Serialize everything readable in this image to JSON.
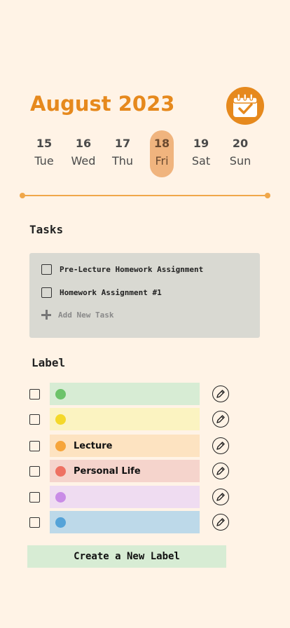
{
  "header": {
    "title": "August 2023",
    "calendar_icon": "calendar-check-icon",
    "accent_color": "#e6891d"
  },
  "days": [
    {
      "num": "15",
      "weekday": "Tue"
    },
    {
      "num": "16",
      "weekday": "Wed"
    },
    {
      "num": "17",
      "weekday": "Thu"
    },
    {
      "num": "18",
      "weekday": "Fri",
      "selected": true
    },
    {
      "num": "19",
      "weekday": "Sat"
    },
    {
      "num": "20",
      "weekday": "Sun"
    }
  ],
  "tasks": {
    "title": "Tasks",
    "items": [
      {
        "label": "Pre-Lecture Homework Assignment",
        "checked": false
      },
      {
        "label": "Homework Assignment #1",
        "checked": false
      }
    ],
    "add_label": "Add New Task"
  },
  "labels": {
    "title": "Label",
    "items": [
      {
        "text": "",
        "bar_color": "#d7ecd4",
        "dot_color": "#6cc36a"
      },
      {
        "text": "",
        "bar_color": "#fbf3c1",
        "dot_color": "#f4d82a"
      },
      {
        "text": "Lecture",
        "bar_color": "#fde3c1",
        "dot_color": "#f6a53a"
      },
      {
        "text": "Personal Life",
        "bar_color": "#f5d4cc",
        "dot_color": "#ee7162"
      },
      {
        "text": "",
        "bar_color": "#efdcf1",
        "dot_color": "#c98ce6"
      },
      {
        "text": "",
        "bar_color": "#bdd9e9",
        "dot_color": "#55a3d8"
      }
    ],
    "edit_icon": "pencil-icon"
  },
  "create_button": {
    "label": "Create a New Label"
  }
}
